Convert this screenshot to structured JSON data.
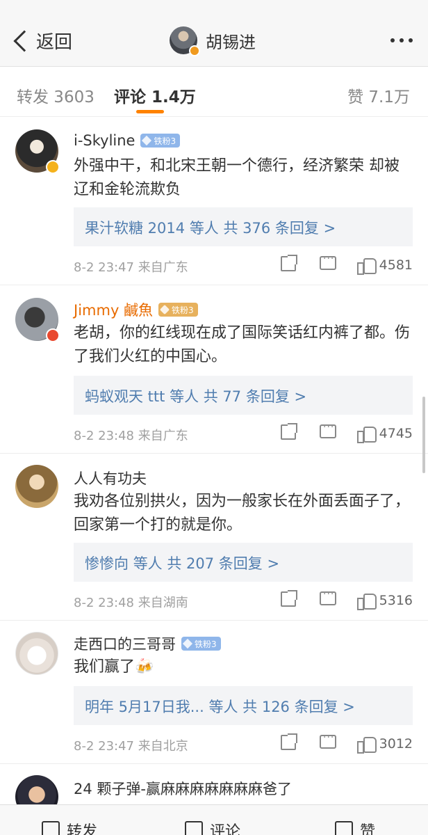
{
  "navbar": {
    "back_label": "返回",
    "title": "胡锡进",
    "back_icon": "chevron-left-icon",
    "more_icon": "more-dots-icon"
  },
  "tabs": {
    "forward": "转发 3603",
    "comment": "评论 1.4万",
    "like": "赞 7.1万"
  },
  "comments": [
    {
      "username": "i-Skyline",
      "fan_badge": "铁粉3",
      "text": "外强中干，和北宋王朝一个德行，经济繁荣 却被辽和金轮流欺负",
      "replies_user": "果汁软糖 2014",
      "replies_count": "等人  共 376 条回复 >",
      "time": "8-2 23:47 来自广东",
      "likes": "4581"
    },
    {
      "username": "Jimmy 鹹魚",
      "fan_badge": "铁粉3",
      "text": "老胡，你的红线现在成了国际笑话红内裤了都。伤了我们火红的中国心。",
      "replies_user": "蚂蚁观天 ttt",
      "replies_count": "等人  共 77 条回复 >",
      "time": "8-2 23:48 来自广东",
      "likes": "4745"
    },
    {
      "username": "人人有功夫",
      "text": "我劝各位别拱火，因为一般家长在外面丢面子了，回家第一个打的就是你。",
      "replies_user": "惨惨向",
      "replies_count": "等人  共 207 条回复 >",
      "time": "8-2 23:48 来自湖南",
      "likes": "5316"
    },
    {
      "username": "走西口的三哥哥",
      "fan_badge": "铁粉3",
      "text": "我们赢了🍻",
      "replies_user": "明年 5月17日我...",
      "replies_count": "等人  共 126 条回复 >",
      "time": "8-2 23:47 来自北京",
      "likes": "3012"
    },
    {
      "username": "24 颗子弹-赢麻麻麻麻麻麻麻爸了"
    }
  ],
  "bottombar": {
    "forward": "转发",
    "comment": "评论",
    "like": "赞"
  },
  "colors": {
    "accent": "#ff8200",
    "link": "#507daf",
    "vip_name": "#e86b00"
  }
}
